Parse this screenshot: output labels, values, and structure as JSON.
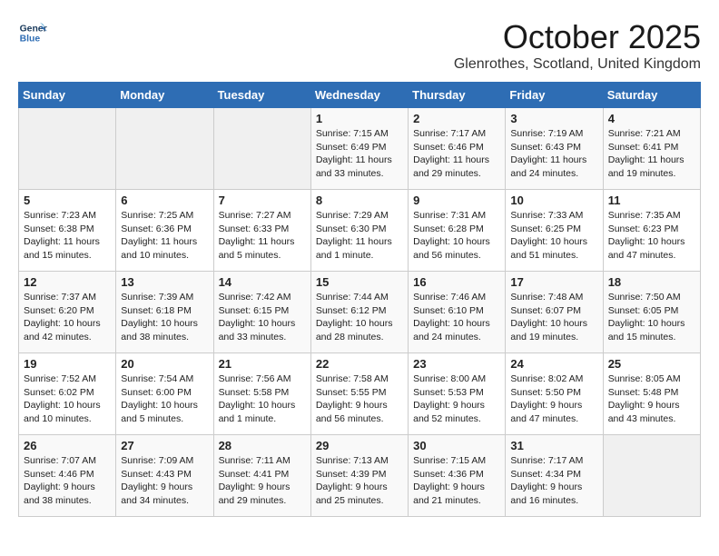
{
  "header": {
    "logo_line1": "General",
    "logo_line2": "Blue",
    "month": "October 2025",
    "location": "Glenrothes, Scotland, United Kingdom"
  },
  "days_of_week": [
    "Sunday",
    "Monday",
    "Tuesday",
    "Wednesday",
    "Thursday",
    "Friday",
    "Saturday"
  ],
  "weeks": [
    [
      {
        "day": "",
        "info": ""
      },
      {
        "day": "",
        "info": ""
      },
      {
        "day": "",
        "info": ""
      },
      {
        "day": "1",
        "info": "Sunrise: 7:15 AM\nSunset: 6:49 PM\nDaylight: 11 hours and 33 minutes."
      },
      {
        "day": "2",
        "info": "Sunrise: 7:17 AM\nSunset: 6:46 PM\nDaylight: 11 hours and 29 minutes."
      },
      {
        "day": "3",
        "info": "Sunrise: 7:19 AM\nSunset: 6:43 PM\nDaylight: 11 hours and 24 minutes."
      },
      {
        "day": "4",
        "info": "Sunrise: 7:21 AM\nSunset: 6:41 PM\nDaylight: 11 hours and 19 minutes."
      }
    ],
    [
      {
        "day": "5",
        "info": "Sunrise: 7:23 AM\nSunset: 6:38 PM\nDaylight: 11 hours and 15 minutes."
      },
      {
        "day": "6",
        "info": "Sunrise: 7:25 AM\nSunset: 6:36 PM\nDaylight: 11 hours and 10 minutes."
      },
      {
        "day": "7",
        "info": "Sunrise: 7:27 AM\nSunset: 6:33 PM\nDaylight: 11 hours and 5 minutes."
      },
      {
        "day": "8",
        "info": "Sunrise: 7:29 AM\nSunset: 6:30 PM\nDaylight: 11 hours and 1 minute."
      },
      {
        "day": "9",
        "info": "Sunrise: 7:31 AM\nSunset: 6:28 PM\nDaylight: 10 hours and 56 minutes."
      },
      {
        "day": "10",
        "info": "Sunrise: 7:33 AM\nSunset: 6:25 PM\nDaylight: 10 hours and 51 minutes."
      },
      {
        "day": "11",
        "info": "Sunrise: 7:35 AM\nSunset: 6:23 PM\nDaylight: 10 hours and 47 minutes."
      }
    ],
    [
      {
        "day": "12",
        "info": "Sunrise: 7:37 AM\nSunset: 6:20 PM\nDaylight: 10 hours and 42 minutes."
      },
      {
        "day": "13",
        "info": "Sunrise: 7:39 AM\nSunset: 6:18 PM\nDaylight: 10 hours and 38 minutes."
      },
      {
        "day": "14",
        "info": "Sunrise: 7:42 AM\nSunset: 6:15 PM\nDaylight: 10 hours and 33 minutes."
      },
      {
        "day": "15",
        "info": "Sunrise: 7:44 AM\nSunset: 6:12 PM\nDaylight: 10 hours and 28 minutes."
      },
      {
        "day": "16",
        "info": "Sunrise: 7:46 AM\nSunset: 6:10 PM\nDaylight: 10 hours and 24 minutes."
      },
      {
        "day": "17",
        "info": "Sunrise: 7:48 AM\nSunset: 6:07 PM\nDaylight: 10 hours and 19 minutes."
      },
      {
        "day": "18",
        "info": "Sunrise: 7:50 AM\nSunset: 6:05 PM\nDaylight: 10 hours and 15 minutes."
      }
    ],
    [
      {
        "day": "19",
        "info": "Sunrise: 7:52 AM\nSunset: 6:02 PM\nDaylight: 10 hours and 10 minutes."
      },
      {
        "day": "20",
        "info": "Sunrise: 7:54 AM\nSunset: 6:00 PM\nDaylight: 10 hours and 5 minutes."
      },
      {
        "day": "21",
        "info": "Sunrise: 7:56 AM\nSunset: 5:58 PM\nDaylight: 10 hours and 1 minute."
      },
      {
        "day": "22",
        "info": "Sunrise: 7:58 AM\nSunset: 5:55 PM\nDaylight: 9 hours and 56 minutes."
      },
      {
        "day": "23",
        "info": "Sunrise: 8:00 AM\nSunset: 5:53 PM\nDaylight: 9 hours and 52 minutes."
      },
      {
        "day": "24",
        "info": "Sunrise: 8:02 AM\nSunset: 5:50 PM\nDaylight: 9 hours and 47 minutes."
      },
      {
        "day": "25",
        "info": "Sunrise: 8:05 AM\nSunset: 5:48 PM\nDaylight: 9 hours and 43 minutes."
      }
    ],
    [
      {
        "day": "26",
        "info": "Sunrise: 7:07 AM\nSunset: 4:46 PM\nDaylight: 9 hours and 38 minutes."
      },
      {
        "day": "27",
        "info": "Sunrise: 7:09 AM\nSunset: 4:43 PM\nDaylight: 9 hours and 34 minutes."
      },
      {
        "day": "28",
        "info": "Sunrise: 7:11 AM\nSunset: 4:41 PM\nDaylight: 9 hours and 29 minutes."
      },
      {
        "day": "29",
        "info": "Sunrise: 7:13 AM\nSunset: 4:39 PM\nDaylight: 9 hours and 25 minutes."
      },
      {
        "day": "30",
        "info": "Sunrise: 7:15 AM\nSunset: 4:36 PM\nDaylight: 9 hours and 21 minutes."
      },
      {
        "day": "31",
        "info": "Sunrise: 7:17 AM\nSunset: 4:34 PM\nDaylight: 9 hours and 16 minutes."
      },
      {
        "day": "",
        "info": ""
      }
    ]
  ]
}
